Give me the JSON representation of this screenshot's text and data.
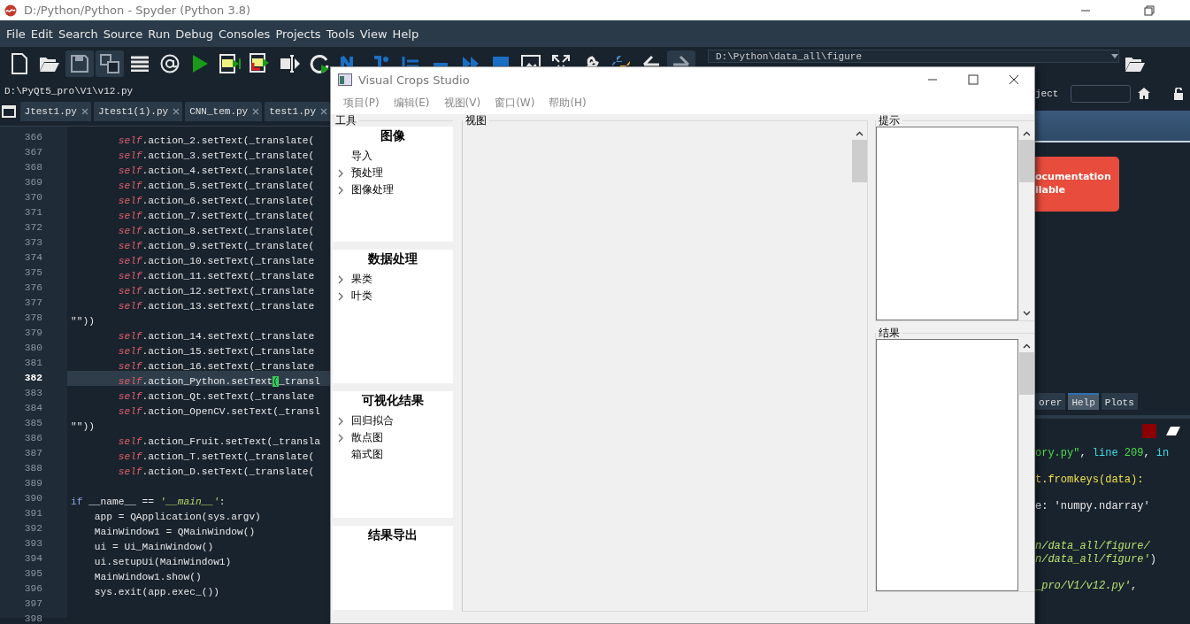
{
  "spyder": {
    "title": "D:/Python/Python - Spyder (Python 3.8)",
    "menu": [
      "File",
      "Edit",
      "Search",
      "Source",
      "Run",
      "Debug",
      "Consoles",
      "Projects",
      "Tools",
      "View",
      "Help"
    ],
    "working_directory": "D:\\Python\\data_all\\figure",
    "file_path": "D:\\PyQt5_pro\\V1\\v12.py",
    "editor_tabs": [
      {
        "label": "Jtest1.py"
      },
      {
        "label": "Jtest1(1).py"
      },
      {
        "label": "CNN_tem.py"
      },
      {
        "label": "test1.py"
      }
    ],
    "code_lines": [
      {
        "number": "366",
        "current": false,
        "segments": [
          {
            "kind": "self",
            "text": "        self"
          },
          {
            "kind": "plain",
            "text": ".action_2.setText(_translate("
          }
        ]
      },
      {
        "number": "367",
        "current": false,
        "segments": [
          {
            "kind": "self",
            "text": "        self"
          },
          {
            "kind": "plain",
            "text": ".action_3.setText(_translate("
          }
        ]
      },
      {
        "number": "368",
        "current": false,
        "segments": [
          {
            "kind": "self",
            "text": "        self"
          },
          {
            "kind": "plain",
            "text": ".action_4.setText(_translate("
          }
        ]
      },
      {
        "number": "369",
        "current": false,
        "segments": [
          {
            "kind": "self",
            "text": "        self"
          },
          {
            "kind": "plain",
            "text": ".action_5.setText(_translate("
          }
        ]
      },
      {
        "number": "370",
        "current": false,
        "segments": [
          {
            "kind": "self",
            "text": "        self"
          },
          {
            "kind": "plain",
            "text": ".action_6.setText(_translate("
          }
        ]
      },
      {
        "number": "371",
        "current": false,
        "segments": [
          {
            "kind": "self",
            "text": "        self"
          },
          {
            "kind": "plain",
            "text": ".action_7.setText(_translate("
          }
        ]
      },
      {
        "number": "372",
        "current": false,
        "segments": [
          {
            "kind": "self",
            "text": "        self"
          },
          {
            "kind": "plain",
            "text": ".action_8.setText(_translate("
          }
        ]
      },
      {
        "number": "373",
        "current": false,
        "segments": [
          {
            "kind": "self",
            "text": "        self"
          },
          {
            "kind": "plain",
            "text": ".action_9.setText(_translate("
          }
        ]
      },
      {
        "number": "374",
        "current": false,
        "segments": [
          {
            "kind": "self",
            "text": "        self"
          },
          {
            "kind": "plain",
            "text": ".action_10.setText(_translate"
          }
        ]
      },
      {
        "number": "375",
        "current": false,
        "segments": [
          {
            "kind": "self",
            "text": "        self"
          },
          {
            "kind": "plain",
            "text": ".action_11.setText(_translate"
          }
        ]
      },
      {
        "number": "376",
        "current": false,
        "segments": [
          {
            "kind": "self",
            "text": "        self"
          },
          {
            "kind": "plain",
            "text": ".action_12.setText(_translate"
          }
        ]
      },
      {
        "number": "377",
        "current": false,
        "segments": [
          {
            "kind": "self",
            "text": "        self"
          },
          {
            "kind": "plain",
            "text": ".action_13.setText(_translate"
          }
        ]
      },
      {
        "number": "378",
        "current": false,
        "segments": [
          {
            "kind": "plain",
            "text": "\"\"))"
          }
        ]
      },
      {
        "number": "379",
        "current": false,
        "segments": [
          {
            "kind": "self",
            "text": "        self"
          },
          {
            "kind": "plain",
            "text": ".action_14.setText(_translate"
          }
        ]
      },
      {
        "number": "380",
        "current": false,
        "segments": [
          {
            "kind": "self",
            "text": "        self"
          },
          {
            "kind": "plain",
            "text": ".action_15.setText(_translate"
          }
        ]
      },
      {
        "number": "381",
        "current": false,
        "segments": [
          {
            "kind": "self",
            "text": "        self"
          },
          {
            "kind": "plain",
            "text": ".action_16.setText(_translate"
          }
        ]
      },
      {
        "number": "382",
        "current": true,
        "segments": [
          {
            "kind": "self",
            "text": "        self"
          },
          {
            "kind": "plain",
            "text": ".action_Python.setText"
          },
          {
            "kind": "match",
            "text": "("
          },
          {
            "kind": "plain",
            "text": "_transl"
          }
        ]
      },
      {
        "number": "383",
        "current": false,
        "segments": [
          {
            "kind": "self",
            "text": "        self"
          },
          {
            "kind": "plain",
            "text": ".action_Qt.setText(_translate"
          }
        ]
      },
      {
        "number": "384",
        "current": false,
        "segments": [
          {
            "kind": "self",
            "text": "        self"
          },
          {
            "kind": "plain",
            "text": ".action_OpenCV.setText(_transl"
          }
        ]
      },
      {
        "number": "385",
        "current": false,
        "segments": [
          {
            "kind": "plain",
            "text": "\"\"))"
          }
        ]
      },
      {
        "number": "386",
        "current": false,
        "segments": [
          {
            "kind": "self",
            "text": "        self"
          },
          {
            "kind": "plain",
            "text": ".action_Fruit.setText(_transla"
          }
        ]
      },
      {
        "number": "387",
        "current": false,
        "segments": [
          {
            "kind": "self",
            "text": "        self"
          },
          {
            "kind": "plain",
            "text": ".action_T.setText(_translate("
          }
        ]
      },
      {
        "number": "388",
        "current": false,
        "segments": [
          {
            "kind": "self",
            "text": "        self"
          },
          {
            "kind": "plain",
            "text": ".action_D.setText(_translate("
          }
        ]
      },
      {
        "number": "389",
        "current": false
      },
      {
        "number": "390",
        "current": false,
        "segments": [
          {
            "kind": "keyword",
            "text": "if"
          },
          {
            "kind": "plain",
            "text": " __name__ == "
          },
          {
            "kind": "string",
            "text": "'__main__'"
          },
          {
            "kind": "plain",
            "text": ":"
          }
        ]
      },
      {
        "number": "391",
        "current": false,
        "segments": [
          {
            "kind": "plain",
            "text": "    app = QApplication(sys.argv)"
          }
        ]
      },
      {
        "number": "392",
        "current": false,
        "segments": [
          {
            "kind": "plain",
            "text": "    MainWindow1 = QMainWindow()"
          }
        ]
      },
      {
        "number": "393",
        "current": false,
        "segments": [
          {
            "kind": "plain",
            "text": "    ui = Ui_MainWindow()"
          }
        ]
      },
      {
        "number": "394",
        "current": false,
        "segments": [
          {
            "kind": "plain",
            "text": "    ui.setupUi(MainWindow1)"
          }
        ]
      },
      {
        "number": "395",
        "current": false,
        "segments": [
          {
            "kind": "plain",
            "text": "    MainWindow1.show()"
          }
        ]
      },
      {
        "number": "396",
        "current": false,
        "segments": [
          {
            "kind": "plain",
            "text": "    sys.exit(app.exec_())"
          }
        ]
      },
      {
        "number": "397",
        "current": false
      },
      {
        "number": "398",
        "current": false
      }
    ],
    "project_label": "ject",
    "help_notice": [
      "ocumentation",
      "ilable"
    ],
    "pane_tabs": [
      {
        "label": "orer",
        "selected": false
      },
      {
        "label": "Help",
        "selected": true
      },
      {
        "label": "Plots",
        "selected": false
      }
    ],
    "console_lines": [
      {
        "kind": "text",
        "segments": [
          {
            "kind": "string",
            "text": "ory.py\""
          },
          {
            "kind": "plain",
            "text": ", "
          },
          {
            "kind": "name",
            "text": "line "
          },
          {
            "kind": "number",
            "text": "209"
          },
          {
            "kind": "plain",
            "text": ", "
          },
          {
            "kind": "name",
            "text": "in"
          }
        ]
      },
      {
        "kind": "blank"
      },
      {
        "kind": "text",
        "segments": [
          {
            "kind": "call",
            "text": "t.fromkeys(data):"
          }
        ]
      },
      {
        "kind": "blank"
      },
      {
        "kind": "text",
        "segments": [
          {
            "kind": "plain",
            "text": "e: 'numpy.ndarray'"
          }
        ]
      },
      {
        "kind": "blank"
      },
      {
        "kind": "blank"
      },
      {
        "kind": "text",
        "segments": [
          {
            "kind": "path",
            "text": "n/data_all/figure/"
          }
        ]
      },
      {
        "kind": "text",
        "segments": [
          {
            "kind": "path",
            "text": "n/data_all/figure'"
          },
          {
            "kind": "plain",
            "text": ")"
          }
        ]
      },
      {
        "kind": "blank"
      },
      {
        "kind": "text",
        "segments": [
          {
            "kind": "path",
            "text": "_pro/V1/v12.py'"
          },
          {
            "kind": "plain",
            "text": ","
          }
        ]
      }
    ]
  },
  "dialog": {
    "title": "Visual Crops Studio",
    "menu": [
      "项目(P)",
      "编辑(E)",
      "视图(V)",
      "窗口(W)",
      "帮助(H)"
    ],
    "tools_group": {
      "title": "工具",
      "sections": [
        {
          "title": "图像",
          "items": [
            {
              "label": "导入",
              "expandable": false
            },
            {
              "label": "预处理",
              "expandable": true
            },
            {
              "label": "图像处理",
              "expandable": true
            }
          ]
        },
        {
          "title": "数据处理",
          "items": [
            {
              "label": "果类",
              "expandable": true
            },
            {
              "label": "叶类",
              "expandable": true
            }
          ]
        },
        {
          "title": "可视化结果",
          "items": [
            {
              "label": "回归拟合",
              "expandable": true
            },
            {
              "label": "散点图",
              "expandable": true
            },
            {
              "label": "箱式图",
              "expandable": false
            }
          ]
        },
        {
          "title": "结果导出"
        }
      ]
    },
    "view_group": {
      "title": "视图"
    },
    "hint_group": {
      "title": "提示"
    },
    "result_group": {
      "title": "结果"
    }
  }
}
